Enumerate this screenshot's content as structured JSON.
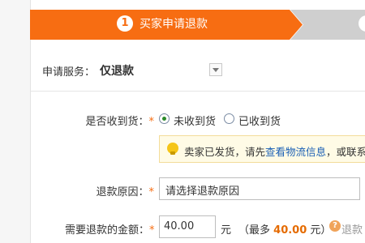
{
  "steps": {
    "active_number": "1",
    "active_label": "买家申请退款"
  },
  "service": {
    "label": "申请服务：",
    "value": "仅退款"
  },
  "received": {
    "label": "是否收到货：",
    "required_mark": "*",
    "options": [
      {
        "label": "未收到货",
        "checked": true
      },
      {
        "label": "已收到货",
        "checked": false
      }
    ]
  },
  "notice": {
    "icon": "lightbulb-icon",
    "text_before": "卖家已发货，请先",
    "link": "查看物流信息",
    "text_after": "，或联系卖"
  },
  "reason": {
    "label": "退款原因：",
    "required_mark": "*",
    "placeholder": "请选择退款原因"
  },
  "amount": {
    "label": "需要退款的金额：",
    "required_mark": "*",
    "value": "40.00",
    "unit": "元",
    "max_prefix": "（最多",
    "max_value": "40.00",
    "max_suffix": "元）",
    "help_icon": "question-icon",
    "help_text": "退款"
  },
  "colors": {
    "accent": "#f76d12",
    "link": "#1a5fb4",
    "notice_bg": "#fffbe6"
  }
}
